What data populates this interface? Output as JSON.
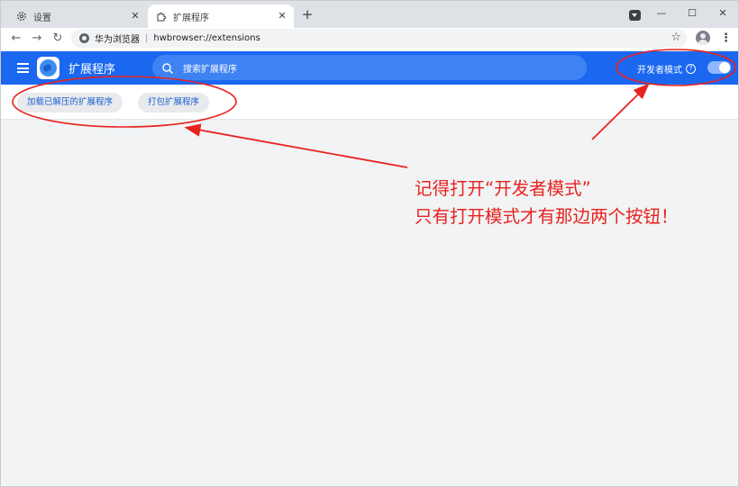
{
  "tabs": [
    {
      "title": "设置",
      "icon": "gear-icon",
      "active": false
    },
    {
      "title": "扩展程序",
      "icon": "puzzle-icon",
      "active": true
    }
  ],
  "address": {
    "site_name": "华为浏览器",
    "url": "hwbrowser://extensions"
  },
  "header": {
    "title": "扩展程序",
    "search_placeholder": "搜索扩展程序",
    "devmode_label": "开发者模式",
    "devmode_on": true
  },
  "actions": {
    "load_unpacked": "加载已解压的扩展程序",
    "pack": "打包扩展程序"
  },
  "annotation": {
    "line1": "记得打开“开发者模式”",
    "line2": "只有打开模式才有那边两个按钮！"
  },
  "colors": {
    "header_blue": "#1b67f0",
    "annotation_red": "#e8221f"
  }
}
